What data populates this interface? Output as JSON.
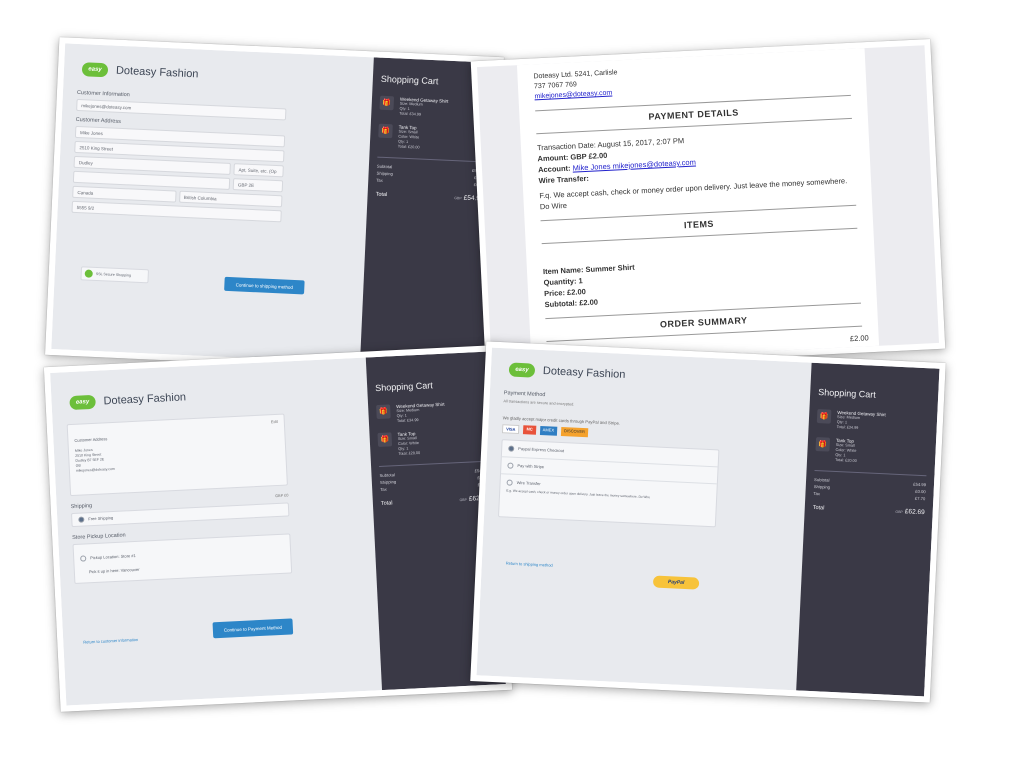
{
  "brand": {
    "logo_text": "easy",
    "name": "Doteasy Fashion"
  },
  "cart": {
    "title": "Shopping Cart",
    "items": [
      {
        "name": "Weekend Getaway Shirt",
        "variant": "Size: Medium",
        "qty": "Qty: 1",
        "total": "Total: £34.99"
      },
      {
        "name": "Tank Top",
        "variant": "Size: Small",
        "color": "Color: White",
        "qty": "Qty: 1",
        "total": "Total: £20.00"
      }
    ]
  },
  "panel1": {
    "customer_info_label": "Customer Information",
    "email": "mikejones@doteasy.com",
    "address_label": "Customer Address",
    "name": "Mike Jones",
    "street": "2510 King Street",
    "city": "Dudley",
    "apt_placeholder": "Apt, Suite, etc. (Op",
    "postcode": "GBP 2E",
    "country": "Canada",
    "province": "British Columbia",
    "phone": "5555 9/2",
    "ssl_badge": "SSL Secure Shopping",
    "continue_button": "Continue to shipping method",
    "subtotal_label": "Subtotal",
    "subtotal": "£54.99",
    "shipping_label": "Shipping",
    "shipping": "£0.00",
    "tax_label": "Tax",
    "tax": "£0.00",
    "total_label": "Total",
    "currency": "GBP",
    "total": "£54.99"
  },
  "panel2": {
    "contact_line": "Doteasy Ltd. 5241, Carlisle",
    "phone_line": "737 7067 769",
    "email_link": "mikejones@doteasy.com",
    "payment_heading": "PAYMENT DETAILS",
    "transaction_date": "Transaction Date: August 15, 2017, 2:07 PM",
    "amount": "Amount: GBP £2.00",
    "account_prefix": "Account:",
    "account_link": "Mike Jones mikejones@doteasy.com",
    "wire_transfer": "Wire Transfer:",
    "note": "F.q. We accept cash, check or money order upon delivery. Just leave the money somewhere. Do Wire",
    "items_heading": "ITEMS",
    "item_name": "Item Name: Summer Shirt",
    "quantity": "Quantity: 1",
    "price": "Price: £2.00",
    "subtotal": "Subtotal: £2.00",
    "order_heading": "ORDER SUMMARY",
    "order_total": "£2.00"
  },
  "panel3": {
    "customer_address_label": "Customer Address",
    "edit_link": "Edit",
    "address_lines": [
      "Mike Jones",
      "2510 King Street",
      "Dudley B7 5EF 2E",
      "GB",
      "mikejones@doteasy.com"
    ],
    "shipping_label": "Shipping",
    "shipping_badge": "GBP £0",
    "free_shipping": "Free Shipping",
    "pickup_label": "Store Pickup Location",
    "pickup_option": "Pickup Location: Store #1",
    "pickup_note": "Pick it up in here: Vancouver",
    "continue_button": "Continue to Payment Method",
    "return_link": "Return to customer information",
    "subtotal_label": "Subtotal",
    "subtotal": "£54.99",
    "shipping_sum_label": "Shipping",
    "shipping_sum": "£0.00",
    "tax_label": "Tax",
    "tax": "£7.70",
    "total_label": "Total",
    "currency": "GBP",
    "total": "£62.69"
  },
  "panel4": {
    "payment_label": "Payment Method",
    "payment_sub": "All transactions are secure and encrypted.",
    "accept_note": "We gladly accept major credit cards through PayPal and Stripe.",
    "cards": [
      "VISA",
      "MC",
      "AMEX",
      "DISCOVER"
    ],
    "option1": "Paypal Express Checkout",
    "option2": "Pay with Stripe",
    "option3": "Wire Transfer",
    "option3_note": "E.g. We accept cash, check or money order upon delivery. Just leave the money somewhere. Do Wire",
    "return_link": "Return to shipping method",
    "paypal_button": "PayPal",
    "subtotal_label": "Subtotal",
    "subtotal": "£54.99",
    "shipping_label": "Shipping",
    "shipping": "£0.00",
    "tax_label": "Tax",
    "tax": "£7.70",
    "total_label": "Total",
    "currency": "GBP",
    "total": "£62.69"
  },
  "colors": {
    "dark_panel": "#3a3946",
    "accent_blue": "#2d86c8",
    "logo_green": "#6cbf3a",
    "paypal_yellow": "#f7c33a"
  }
}
